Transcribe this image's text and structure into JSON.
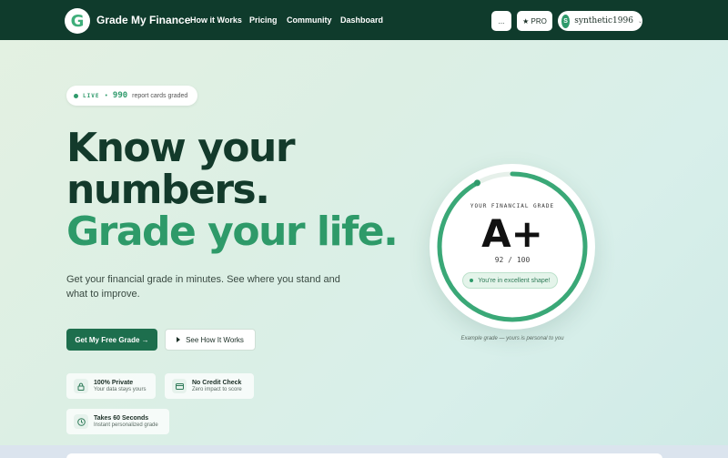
{
  "nav": {
    "logo_letter": "G",
    "brand": "Grade My Finance",
    "links": [
      "How it Works",
      "Pricing",
      "Community",
      "Dashboard"
    ],
    "more_label": "...",
    "pro_label": "★ PRO",
    "user": {
      "initial": "S",
      "name": "synthetic1996",
      "caret": "⌄"
    }
  },
  "badge": {
    "live": "LIVE",
    "sep": "•",
    "count": "990",
    "label": "report cards graded"
  },
  "hero": {
    "line1": "Know your",
    "line2": "numbers.",
    "line3": "Grade your life.",
    "subtitle": "Get your financial grade in minutes. See where you stand and what to improve.",
    "cta_primary": "Get My Free Grade →",
    "cta_secondary": "See How It Works"
  },
  "features": [
    {
      "icon": "lock-icon",
      "title": "100% Private",
      "sub": "Your data stays yours"
    },
    {
      "icon": "card-icon",
      "title": "No Credit Check",
      "sub": "Zero impact to score"
    },
    {
      "icon": "clock-icon",
      "title": "Takes 60 Seconds",
      "sub": "Instant personalized grade"
    }
  ],
  "grade": {
    "label": "YOUR FINANCIAL GRADE",
    "value": "A+",
    "score": "92 / 100",
    "status": "You're in excellent shape!",
    "score_fraction": 0.92,
    "caption": "Example grade — yours is personal to you"
  },
  "colors": {
    "nav_bg": "#0f3b2c",
    "accent": "#2e9a69",
    "cta": "#1d6e4d"
  }
}
